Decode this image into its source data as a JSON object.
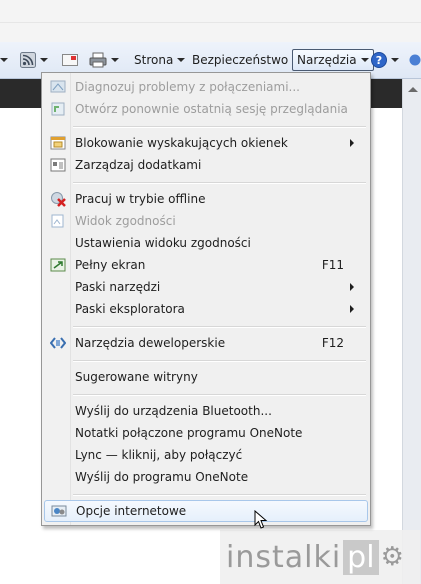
{
  "toolbar": {
    "strona": "Strona",
    "bezpieczenstwo": "Bezpieczeństwo",
    "narzedzia": "Narzędzia"
  },
  "menu": {
    "items": [
      {
        "label": "Diagnozuj problemy z połączeniami...",
        "shortcut": "",
        "disabled": true,
        "icon": "diagnose-connection-icon"
      },
      {
        "label": "Otwórz ponownie ostatnią sesję przeglądania",
        "shortcut": "",
        "disabled": true,
        "icon": "reopen-session-icon"
      },
      {
        "label": "Blokowanie wyskakujących okienek",
        "shortcut": "",
        "submenu": true,
        "icon": "popup-blocker-icon"
      },
      {
        "label": "Zarządzaj dodatkami",
        "shortcut": "",
        "icon": "manage-addons-icon"
      },
      {
        "label": "Pracuj w trybie offline",
        "shortcut": "",
        "icon": "offline-icon"
      },
      {
        "label": "Widok zgodności",
        "shortcut": "",
        "disabled": true,
        "icon": "compatibility-view-icon"
      },
      {
        "label": "Ustawienia widoku zgodności",
        "shortcut": ""
      },
      {
        "label": "Pełny ekran",
        "shortcut": "F11",
        "icon": "fullscreen-icon"
      },
      {
        "label": "Paski narzędzi",
        "shortcut": "",
        "submenu": true
      },
      {
        "label": "Paski eksploratora",
        "shortcut": "",
        "submenu": true
      },
      {
        "label": "Narzędzia deweloperskie",
        "shortcut": "F12",
        "icon": "developer-tools-icon"
      },
      {
        "label": "Sugerowane witryny",
        "shortcut": ""
      },
      {
        "label": "Wyślij do urządzenia Bluetooth...",
        "shortcut": ""
      },
      {
        "label": "Notatki połączone programu OneNote",
        "shortcut": ""
      },
      {
        "label": "Lync — kliknij, aby połączyć",
        "shortcut": ""
      },
      {
        "label": "Wyślij do programu OneNote",
        "shortcut": ""
      },
      {
        "label": "Opcje internetowe",
        "shortcut": "",
        "icon": "internet-options-icon",
        "highlighted": true
      }
    ]
  },
  "watermark": {
    "text": "instalki",
    "suffix": "pl"
  }
}
